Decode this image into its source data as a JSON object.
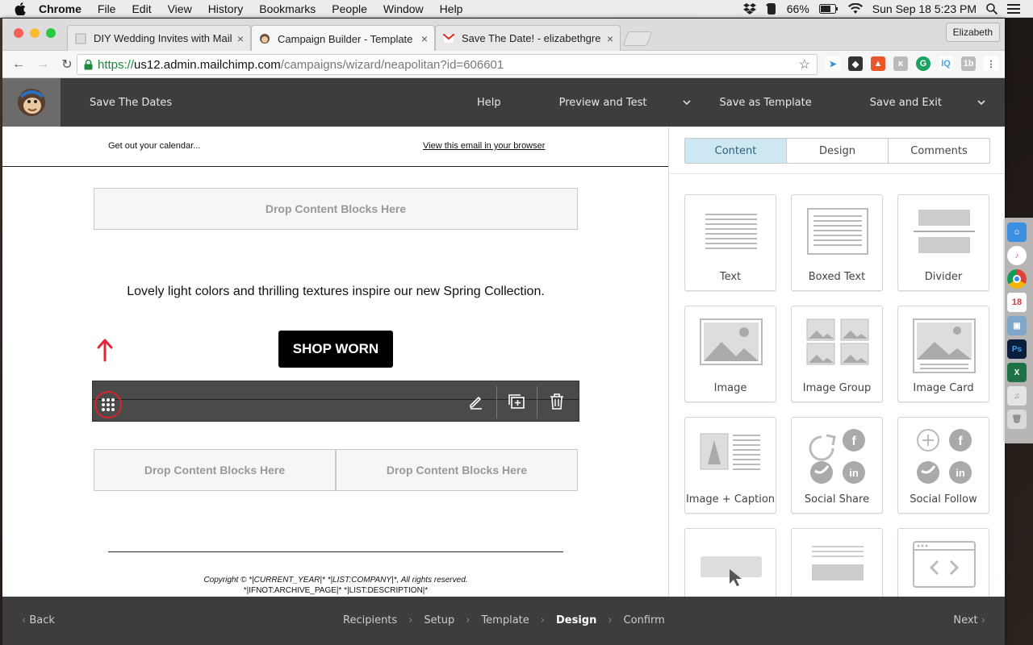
{
  "menubar": {
    "app": "Chrome",
    "items": [
      "File",
      "Edit",
      "View",
      "History",
      "Bookmarks",
      "People",
      "Window",
      "Help"
    ],
    "battery": "66%",
    "datetime": "Sun Sep 18  5:23 PM"
  },
  "browser": {
    "tabs": [
      {
        "title": "DIY Wedding Invites with Mailc"
      },
      {
        "title": "Campaign Builder - Template D"
      },
      {
        "title": "Save The Date! - elizabethgre"
      }
    ],
    "profile": "Elizabeth",
    "url": {
      "scheme": "https://",
      "domain": "us12.admin.mailchimp.com",
      "path": "/campaigns/wizard/neapolitan?id=606601"
    }
  },
  "header": {
    "title": "Save The Dates",
    "help": "Help",
    "preview": "Preview and Test",
    "save_template": "Save as Template",
    "save_exit": "Save and Exit"
  },
  "email": {
    "preheader_left": "Get out your calendar...",
    "preheader_right": "View this email in your browser",
    "drop_label": "Drop Content Blocks Here",
    "tagline": "Lovely light colors and thrilling textures inspire our new Spring Collection.",
    "button": "SHOP WORN",
    "copyright": "Copyright © *|CURRENT_YEAR|* *|LIST:COMPANY|*, All rights reserved.",
    "archive": "*|IFNOT:ARCHIVE_PAGE|* *|LIST:DESCRIPTION|*"
  },
  "panel": {
    "tabs": [
      "Content",
      "Design",
      "Comments"
    ],
    "active_tab": "Content",
    "blocks": [
      "Text",
      "Boxed Text",
      "Divider",
      "Image",
      "Image Group",
      "Image Card",
      "Image + Caption",
      "Social Share",
      "Social Follow"
    ]
  },
  "steps": {
    "back": "Back",
    "items": [
      "Recipients",
      "Setup",
      "Template",
      "Design",
      "Confirm"
    ],
    "current": "Design",
    "next": "Next"
  },
  "colors": {
    "accent": "#d9232b",
    "tab_active_bg": "#cde8f2",
    "header_bg": "#3d3d3d"
  }
}
